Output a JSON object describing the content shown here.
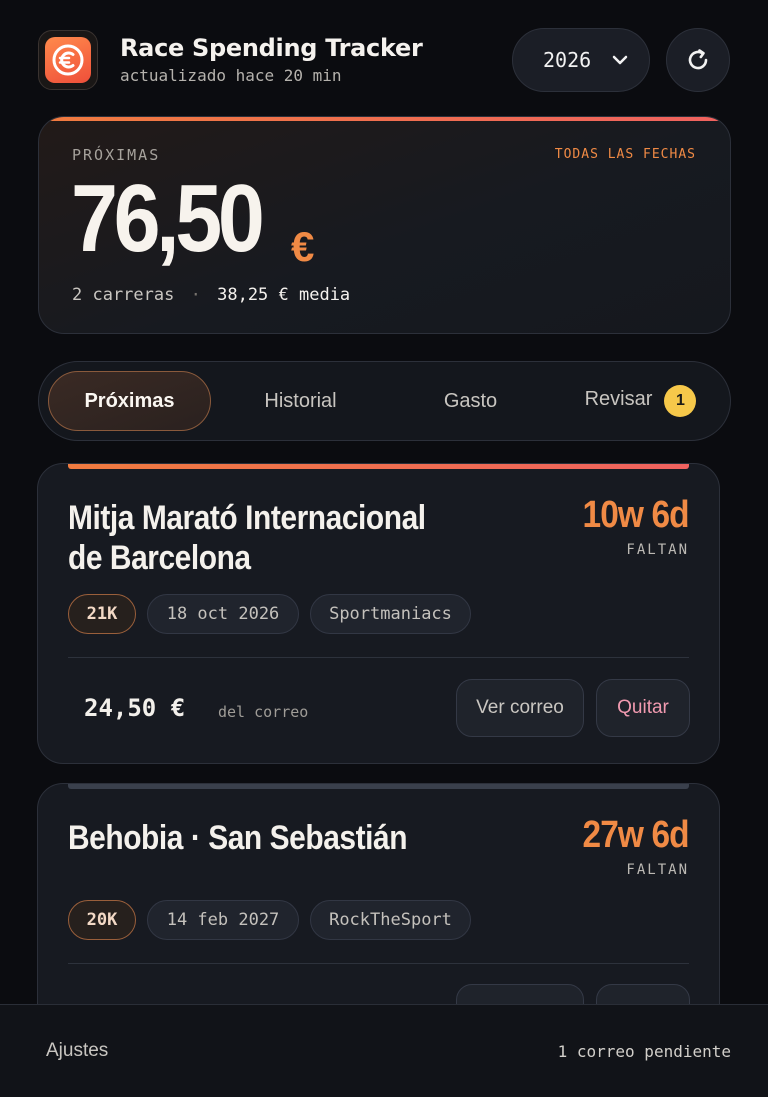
{
  "app": {
    "title": "Race Spending Tracker",
    "subtitle": "actualizado hace 20 min",
    "logo_icon": "euro-icon",
    "accent_color": "#f08a45"
  },
  "year_select": {
    "value": "2026"
  },
  "summary": {
    "label": "PRÓXIMAS",
    "link": "TODAS LAS FECHAS",
    "amount": "76,50",
    "currency": "€",
    "race_count": "2 carreras",
    "separator": "·",
    "average": "38,25 € media"
  },
  "tabs": [
    {
      "label": "Próximas",
      "active": true
    },
    {
      "label": "Historial",
      "active": false
    },
    {
      "label": "Gasto",
      "active": false
    },
    {
      "label": "Revisar",
      "active": false,
      "badge": "1"
    }
  ],
  "races": [
    {
      "title": "Mitja Marató Internacional de Barcelona",
      "countdown": "10w 6d",
      "countdown_label": "FALTAN",
      "distance": "21K",
      "date": "18 oct 2026",
      "organizer": "Sportmaniacs",
      "price": "24,50 €",
      "price_note": "del correo",
      "view_button": "Ver correo",
      "remove_button": "Quitar"
    },
    {
      "title": "Behobia · San Sebastián",
      "countdown": "27w 6d",
      "countdown_label": "FALTAN",
      "distance": "20K",
      "date": "14 feb 2027",
      "organizer": "RockTheSport"
    }
  ],
  "footer": {
    "settings": "Ajustes",
    "pending": "1 correo pendiente"
  }
}
